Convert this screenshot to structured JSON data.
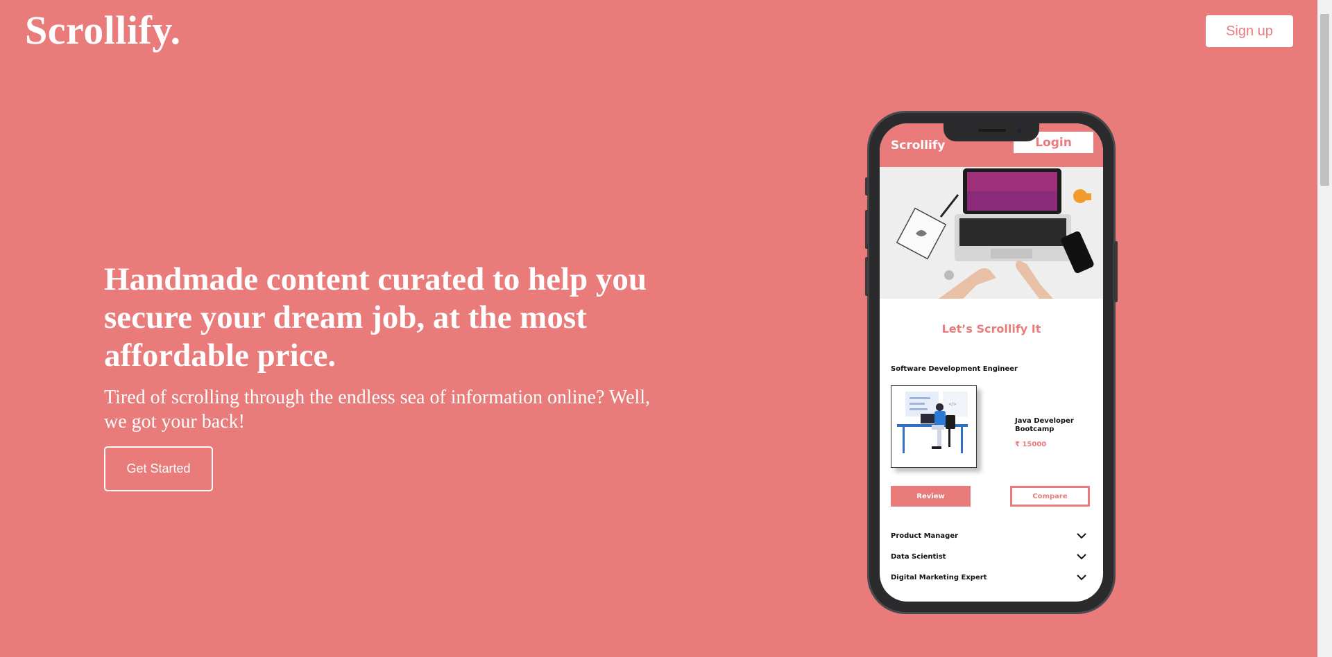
{
  "brand": {
    "logo": "Scrollify.",
    "signup_label": "Sign up"
  },
  "hero": {
    "title": "Handmade content curated to help you secure your dream job, at the most affordable price.",
    "subtitle": "Tired of scrolling through the endless sea of information online? Well, we got your back!",
    "cta_label": "Get Started"
  },
  "phone_app": {
    "logo": "Scrollify",
    "login_label": "Login",
    "tagline": "Let’s Scrollify It",
    "featured_job": "Software Development Engineer",
    "course": {
      "name": "Java Developer Bootcamp",
      "price": "₹ 15000"
    },
    "review_label": "Review",
    "compare_label": "Compare",
    "accordion": [
      {
        "label": "Product Manager"
      },
      {
        "label": "Data Scientist"
      },
      {
        "label": "Digital Marketing Expert"
      }
    ]
  },
  "colors": {
    "accent": "#e97b7b",
    "text_light": "#ffffff",
    "phone_frame": "#2b2b2e"
  }
}
